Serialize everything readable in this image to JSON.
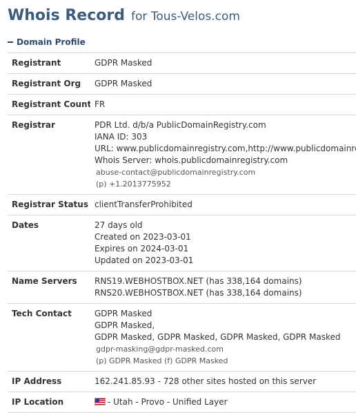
{
  "header": {
    "title": "Whois Record",
    "subtitle": "for Tous-Velos.com"
  },
  "section": {
    "label": "Domain Profile"
  },
  "rows": {
    "registrant": {
      "label": "Registrant",
      "value": "GDPR Masked"
    },
    "registrant_org": {
      "label": "Registrant Org",
      "value": "GDPR Masked"
    },
    "registrant_country": {
      "label": "Registrant Country",
      "value": "FR"
    },
    "registrar": {
      "label": "Registrar",
      "line1": "PDR Ltd. d/b/a PublicDomainRegistry.com",
      "line2": "IANA ID: 303",
      "line3": "URL: www.publicdomainregistry.com,http://www.publicdomainregi",
      "line4": "Whois Server: whois.publicdomainregistry.com",
      "email": "abuse-contact@publicdomainregistry.com",
      "phone": "(p)  +1.2013775952"
    },
    "registrar_status": {
      "label": "Registrar Status",
      "value": "clientTransferProhibited"
    },
    "dates": {
      "label": "Dates",
      "age": "27 days old",
      "created": "Created on 2023-03-01",
      "expires": "Expires on 2024-03-01",
      "updated": "Updated on 2023-03-01"
    },
    "name_servers": {
      "label": "Name Servers",
      "ns1": "RNS19.WEBHOSTBOX.NET (has 338,164 domains)",
      "ns2": "RNS20.WEBHOSTBOX.NET (has 338,164 domains)"
    },
    "tech_contact": {
      "label": "Tech Contact",
      "line1": "GDPR Masked",
      "line2": "GDPR Masked,",
      "line3": "GDPR Masked, GDPR Masked, GDPR Masked, GDPR Masked",
      "email": "gdpr-masking@gdpr-masked.com",
      "phone_fax": "(p)  GDPR Masked   (f)  GDPR Masked"
    },
    "ip_address": {
      "label": "IP Address",
      "value": "162.241.85.93 - 728 other sites hosted on this server"
    },
    "ip_location": {
      "label": "IP Location",
      "value": "- Utah - Provo - Unified Layer"
    }
  }
}
